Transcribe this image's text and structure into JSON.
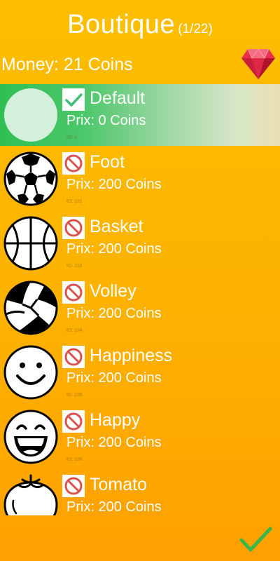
{
  "shop": {
    "title": "Boutique",
    "page_indicator": "(1/22)",
    "money": "Money: 21 Coins"
  },
  "items": [
    {
      "name": "Default",
      "price": "Prix: 0 Coins",
      "id": "ID: 0",
      "status": "owned-selected",
      "icon": "plain-ball-icon"
    },
    {
      "name": "Foot",
      "price": "Prix: 200 Coins",
      "id": "ID: 101",
      "status": "locked",
      "icon": "soccer-ball-icon"
    },
    {
      "name": "Basket",
      "price": "Prix: 200 Coins",
      "id": "ID: 102",
      "status": "locked",
      "icon": "basketball-icon"
    },
    {
      "name": "Volley",
      "price": "Prix: 200 Coins",
      "id": "ID: 104",
      "status": "locked",
      "icon": "volleyball-icon"
    },
    {
      "name": "Happiness",
      "price": "Prix: 200 Coins",
      "id": "ID: 105",
      "status": "locked",
      "icon": "smiley-face-icon"
    },
    {
      "name": "Happy",
      "price": "Prix: 200 Coins",
      "id": "ID: 106",
      "status": "locked",
      "icon": "grin-face-icon"
    },
    {
      "name": "Tomato",
      "price": "Prix: 200 Coins",
      "id": "",
      "status": "locked",
      "icon": "tomato-icon"
    }
  ],
  "colors": {
    "background": "#fdb800",
    "selected_row": "#2fbf55",
    "locked_icon": "#d9534f",
    "confirm_check": "#3cb54a"
  },
  "icons": {
    "gem": "ruby-gem-icon",
    "owned": "checkmark-icon",
    "locked": "blocked-icon",
    "confirm": "confirm-check-icon"
  }
}
